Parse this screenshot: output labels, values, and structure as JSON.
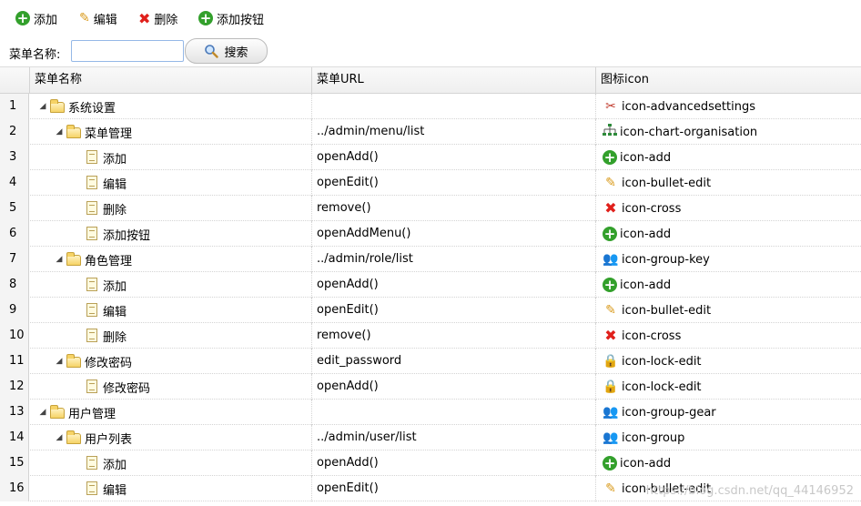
{
  "toolbar": {
    "add_label": "添加",
    "edit_label": "编辑",
    "delete_label": "删除",
    "add_button_label": "添加按钮"
  },
  "search": {
    "label": "菜单名称:",
    "value": "",
    "placeholder": "",
    "button_label": "搜索"
  },
  "grid": {
    "headers": {
      "name": "菜单名称",
      "url": "菜单URL",
      "icon": "图标icon"
    },
    "rows": [
      {
        "num": "1",
        "name": "系统设置",
        "url": "",
        "icon": "icon-advancedsettings",
        "glyph": "wrench-icon",
        "node": "folder",
        "level": 0
      },
      {
        "num": "2",
        "name": "菜单管理",
        "url": "../admin/menu/list",
        "icon": "icon-chart-organisation",
        "glyph": "org-chart-icon",
        "node": "folder",
        "level": 1
      },
      {
        "num": "3",
        "name": "添加",
        "url": "openAdd()",
        "icon": "icon-add",
        "glyph": "add-icon",
        "node": "file",
        "level": 2
      },
      {
        "num": "4",
        "name": "编辑",
        "url": "openEdit()",
        "icon": "icon-bullet-edit",
        "glyph": "pencil-icon",
        "node": "file",
        "level": 2
      },
      {
        "num": "5",
        "name": "删除",
        "url": "remove()",
        "icon": "icon-cross",
        "glyph": "cross-icon",
        "node": "file",
        "level": 2
      },
      {
        "num": "6",
        "name": "添加按钮",
        "url": "openAddMenu()",
        "icon": "icon-add",
        "glyph": "add-icon",
        "node": "file",
        "level": 2
      },
      {
        "num": "7",
        "name": "角色管理",
        "url": "../admin/role/list",
        "icon": "icon-group-key",
        "glyph": "group-key-icon",
        "node": "folder",
        "level": 1
      },
      {
        "num": "8",
        "name": "添加",
        "url": "openAdd()",
        "icon": "icon-add",
        "glyph": "add-icon",
        "node": "file",
        "level": 2
      },
      {
        "num": "9",
        "name": "编辑",
        "url": "openEdit()",
        "icon": "icon-bullet-edit",
        "glyph": "pencil-icon",
        "node": "file",
        "level": 2
      },
      {
        "num": "10",
        "name": "删除",
        "url": "remove()",
        "icon": "icon-cross",
        "glyph": "cross-icon",
        "node": "file",
        "level": 2
      },
      {
        "num": "11",
        "name": "修改密码",
        "url": "edit_password",
        "icon": "icon-lock-edit",
        "glyph": "lock-edit-icon",
        "node": "folder",
        "level": 1
      },
      {
        "num": "12",
        "name": "修改密码",
        "url": "openAdd()",
        "icon": "icon-lock-edit",
        "glyph": "lock-edit-icon",
        "node": "file",
        "level": 2
      },
      {
        "num": "13",
        "name": "用户管理",
        "url": "",
        "icon": "icon-group-gear",
        "glyph": "group-gear-icon",
        "node": "folder",
        "level": 0
      },
      {
        "num": "14",
        "name": "用户列表",
        "url": "../admin/user/list",
        "icon": "icon-group",
        "glyph": "group-icon",
        "node": "folder",
        "level": 1
      },
      {
        "num": "15",
        "name": "添加",
        "url": "openAdd()",
        "icon": "icon-add",
        "glyph": "add-icon",
        "node": "file",
        "level": 2
      },
      {
        "num": "16",
        "name": "编辑",
        "url": "openEdit()",
        "icon": "icon-bullet-edit",
        "glyph": "pencil-icon",
        "node": "file",
        "level": 2
      }
    ]
  },
  "watermark": "https://blog.csdn.net/qq_44146952"
}
